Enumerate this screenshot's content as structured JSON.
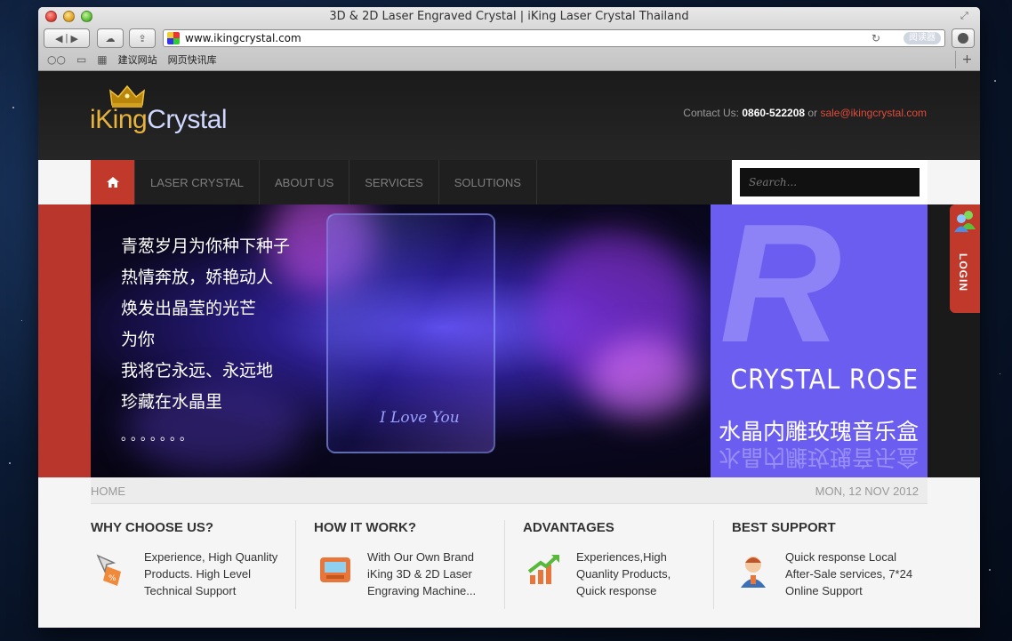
{
  "browser": {
    "window_title": "3D & 2D Laser Engraved Crystal | iKing Laser Crystal Thailand",
    "url": "www.ikingcrystal.com",
    "reader_label": "阅读器",
    "bookmarks": [
      "建议网站",
      "网页快讯库"
    ]
  },
  "header": {
    "logo_part1": "iKing",
    "logo_part2": "Crystal",
    "contact_label": "Contact Us:",
    "phone": "0860-522208",
    "or": "or",
    "email": "sale@ikingcrystal.com"
  },
  "nav": {
    "items": [
      "LASER CRYSTAL",
      "ABOUT US",
      "SERVICES",
      "SOLUTIONS"
    ],
    "search_placeholder": "Search..."
  },
  "banner": {
    "poem": [
      "青葱岁月为你种下种子",
      "热情奔放，娇艳动人",
      "焕发出晶莹的光芒",
      "为你",
      "我将它永远、永远地",
      "珍藏在水晶里"
    ],
    "dots": "。。。。。。。",
    "crystal_text": "I Love You",
    "promo_letter": "R",
    "promo_title": "CRYSTAL ROSE",
    "promo_subtitle": "水晶内雕玫瑰音乐盒"
  },
  "login_tab": {
    "label": "LOGIN"
  },
  "breadcrumb": {
    "home": "HOME",
    "date": "MON,  12 NOV 2012"
  },
  "features": [
    {
      "title": "WHY CHOOSE US?",
      "lines": [
        "Experience, High Quanlity",
        "Products. High Level",
        "Technical Support"
      ],
      "icon": "cursor-tag-icon"
    },
    {
      "title": "HOW IT WORK?",
      "lines": [
        "With Our Own Brand",
        "iKing 3D & 2D Laser",
        "Engraving Machine..."
      ],
      "icon": "machine-icon"
    },
    {
      "title": "ADVANTAGES",
      "lines": [
        "Experiences,High",
        "Quanlity Products,",
        "Quick response"
      ],
      "icon": "growth-chart-icon"
    },
    {
      "title": "BEST SUPPORT",
      "lines": [
        "Quick response Local",
        "After-Sale services, 7*24",
        "Online Support"
      ],
      "icon": "support-agent-icon"
    }
  ],
  "colors": {
    "accent_red": "#c0392b",
    "promo_purple": "#6b5df0",
    "logo_gold": "#e8b33a"
  }
}
